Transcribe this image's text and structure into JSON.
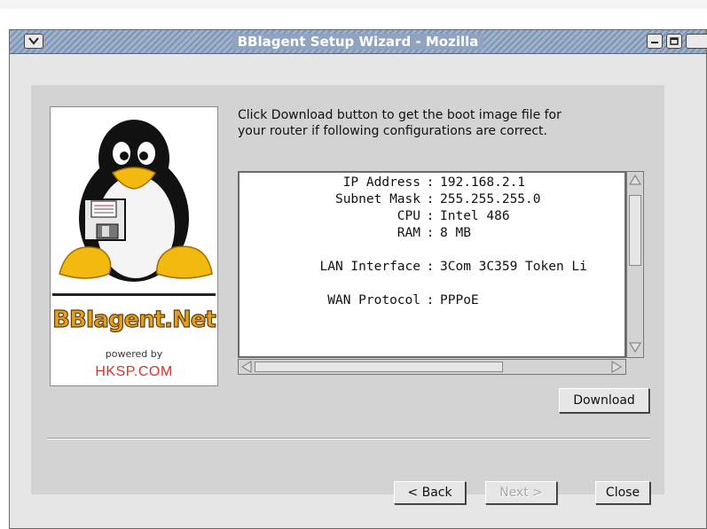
{
  "window": {
    "title": "BBlagent Setup Wizard - Mozilla"
  },
  "logo": {
    "brand": "BBIagent.Net",
    "powered_by": "powered by",
    "company": "HKSP.COM"
  },
  "instructions": "Click Download button to get the boot image file for your router if following configurations are correct.",
  "config": {
    "rows": [
      {
        "label": "IP Address",
        "sep": ":",
        "value": "192.168.2.1"
      },
      {
        "label": "Subnet Mask",
        "sep": ":",
        "value": "255.255.255.0"
      },
      {
        "label": "CPU",
        "sep": ":",
        "value": "Intel 486"
      },
      {
        "label": "RAM",
        "sep": ":",
        "value": "8 MB"
      },
      {
        "label": "",
        "sep": "",
        "value": ""
      },
      {
        "label": "LAN Interface",
        "sep": ":",
        "value": "3Com 3C359 Token Li"
      },
      {
        "label": "",
        "sep": "",
        "value": ""
      },
      {
        "label": "WAN Protocol",
        "sep": ":",
        "value": "PPPoE"
      }
    ]
  },
  "buttons": {
    "download": "Download",
    "back": "< Back",
    "next": "Next >",
    "close": "Close"
  },
  "icons": {
    "window_menu": "chevron-down-icon",
    "minimize": "minimize-icon",
    "maximize": "maximize-icon",
    "logo_image": "tux-penguin-floppy-icon"
  }
}
